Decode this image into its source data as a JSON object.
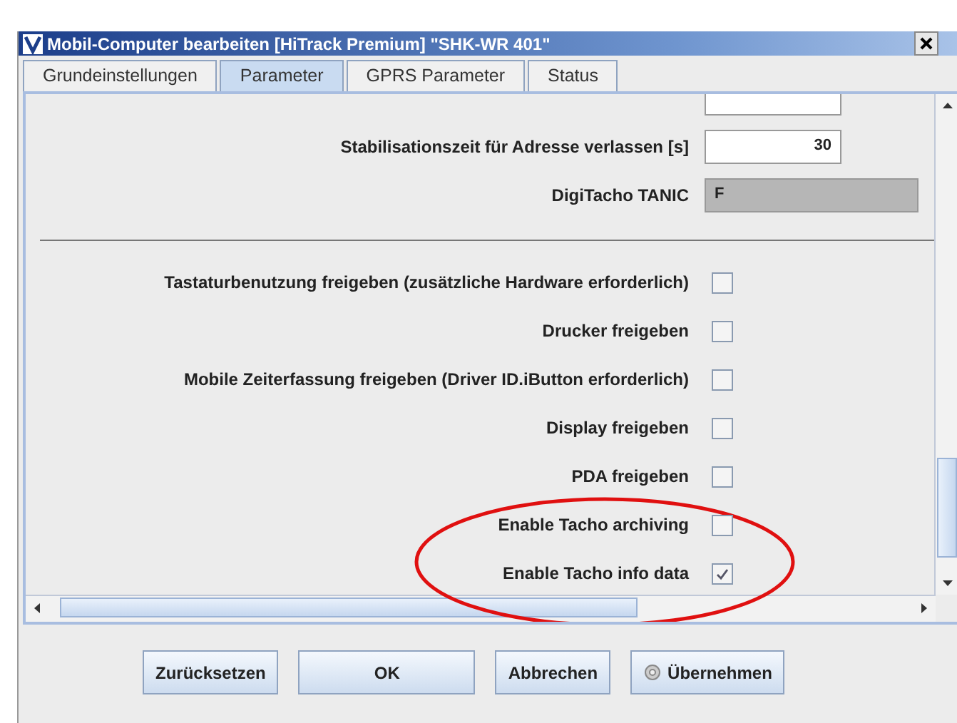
{
  "window": {
    "title": "Mobil-Computer bearbeiten [HiTrack Premium] \"SHK-WR 401\""
  },
  "tabs": [
    {
      "label": "Grundeinstellungen",
      "selected": false
    },
    {
      "label": "Parameter",
      "selected": true
    },
    {
      "label": "GPRS Parameter",
      "selected": false
    },
    {
      "label": "Status",
      "selected": false
    }
  ],
  "fields": [
    {
      "label": "Stabilisationszeit für Adresse verlassen [s]",
      "value": "30",
      "disabled": false
    },
    {
      "label": "DigiTacho TANIC",
      "value": "F",
      "disabled": true
    }
  ],
  "options": [
    {
      "label": "Tastaturbenutzung freigeben (zusätzliche Hardware erforderlich)",
      "checked": false
    },
    {
      "label": "Drucker freigeben",
      "checked": false
    },
    {
      "label": "Mobile Zeiterfassung freigeben (Driver ID.iButton erforderlich)",
      "checked": false
    },
    {
      "label": "Display freigeben",
      "checked": false
    },
    {
      "label": "PDA freigeben",
      "checked": false
    },
    {
      "label": "Enable Tacho archiving",
      "checked": false
    },
    {
      "label": "Enable Tacho info data",
      "checked": true
    }
  ],
  "buttons": [
    {
      "label": "Zurücksetzen",
      "kind": "plain"
    },
    {
      "label": "OK",
      "kind": "plain"
    },
    {
      "label": "Abbrechen",
      "kind": "plain"
    },
    {
      "label": "Übernehmen",
      "kind": "apply"
    }
  ]
}
